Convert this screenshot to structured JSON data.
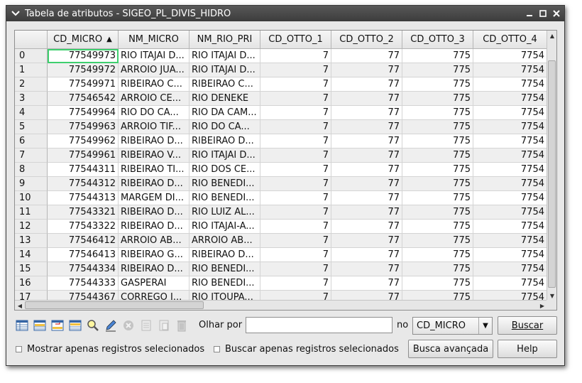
{
  "window": {
    "title": "Tabela de atributos - SIGEO_PL_DIVIS_HIDRO"
  },
  "table": {
    "columns": [
      "CD_MICRO",
      "NM_MICRO",
      "NM_RIO_PRI",
      "CD_OTTO_1",
      "CD_OTTO_2",
      "CD_OTTO_3",
      "CD_OTTO_4"
    ],
    "sorted_column": "CD_MICRO",
    "sort_direction": "ascending",
    "rows": [
      {
        "id": "0",
        "cells": [
          "77549973",
          "RIO ITAJAI D...",
          "RIO ITAJAI D...",
          "7",
          "77",
          "775",
          "7754"
        ]
      },
      {
        "id": "1",
        "cells": [
          "77549972",
          "ARROIO JUA...",
          "RIO ITAJAI D...",
          "7",
          "77",
          "775",
          "7754"
        ]
      },
      {
        "id": "2",
        "cells": [
          "77549971",
          "RIBEIRAO C...",
          "RIBEIRAO C...",
          "7",
          "77",
          "775",
          "7754"
        ]
      },
      {
        "id": "3",
        "cells": [
          "77546542",
          "ARROIO CE...",
          "RIO DENEKE",
          "7",
          "77",
          "775",
          "7754"
        ]
      },
      {
        "id": "4",
        "cells": [
          "77549964",
          "RIO DO CA...",
          "RIO DA CAM...",
          "7",
          "77",
          "775",
          "7754"
        ]
      },
      {
        "id": "5",
        "cells": [
          "77549963",
          "ARROIO TIF...",
          "RIO DO CA...",
          "7",
          "77",
          "775",
          "7754"
        ]
      },
      {
        "id": "6",
        "cells": [
          "77549962",
          "RIBEIRAO D...",
          "RIBEIRAO D...",
          "7",
          "77",
          "775",
          "7754"
        ]
      },
      {
        "id": "7",
        "cells": [
          "77549961",
          "RIBEIRAO V...",
          "RIO ITAJAI D...",
          "7",
          "77",
          "775",
          "7754"
        ]
      },
      {
        "id": "8",
        "cells": [
          "77544311",
          "RIBEIRAO TI...",
          "RIO DOS CE...",
          "7",
          "77",
          "775",
          "7754"
        ]
      },
      {
        "id": "9",
        "cells": [
          "77544312",
          "RIBEIRAO D...",
          "RIO BENEDI...",
          "7",
          "77",
          "775",
          "7754"
        ]
      },
      {
        "id": "10",
        "cells": [
          "77544313",
          "MARGEM DI...",
          "RIO BENEDI...",
          "7",
          "77",
          "775",
          "7754"
        ]
      },
      {
        "id": "11",
        "cells": [
          "77543321",
          "RIBEIRAO D...",
          "RIO LUIZ AL...",
          "7",
          "77",
          "775",
          "7754"
        ]
      },
      {
        "id": "12",
        "cells": [
          "77543322",
          "RIBEIRAO D...",
          "RIO ITAJAI-A...",
          "7",
          "77",
          "775",
          "7754"
        ]
      },
      {
        "id": "13",
        "cells": [
          "77546412",
          "ARROIO AB...",
          "ARROIO AB...",
          "7",
          "77",
          "775",
          "7754"
        ]
      },
      {
        "id": "14",
        "cells": [
          "77546413",
          "RIBEIRAO G...",
          "RIBEIRAO D...",
          "7",
          "77",
          "775",
          "7754"
        ]
      },
      {
        "id": "15",
        "cells": [
          "77544334",
          "RIBEIRAO D...",
          "RIO BENEDI...",
          "7",
          "77",
          "775",
          "7754"
        ]
      },
      {
        "id": "16",
        "cells": [
          "77544333",
          "GASPERAI",
          "RIO BENEDI...",
          "7",
          "77",
          "775",
          "7754"
        ]
      },
      {
        "id": "17",
        "cells": [
          "77544367",
          "CORREGO I...",
          "RIO ITOUPA...",
          "7",
          "77",
          "775",
          "7754"
        ]
      }
    ],
    "selected_cell": "0:CD_MICRO"
  },
  "toolbar": {
    "icons": [
      "table-icon",
      "select-rows-icon",
      "invert-selection-icon",
      "move-to-top-icon",
      "zoom-to-selection-icon",
      "edit-icon",
      "delete-icon",
      "copy-icon",
      "paste-icon",
      "trash-icon"
    ]
  },
  "search": {
    "label": "Olhar por",
    "value": "",
    "in_label": "no",
    "field_selected": "CD_MICRO",
    "search_button": "Buscar",
    "advanced_button": "Busca avançada",
    "help_button": "Help",
    "show_selected_only": "Mostrar apenas registros selecionados",
    "search_selected_only": "Buscar apenas registros selecionados"
  },
  "colors": {
    "titlebar": "#4a4a4a",
    "selection_outline": "#3ecf6e",
    "alt_row": "#efefef"
  }
}
